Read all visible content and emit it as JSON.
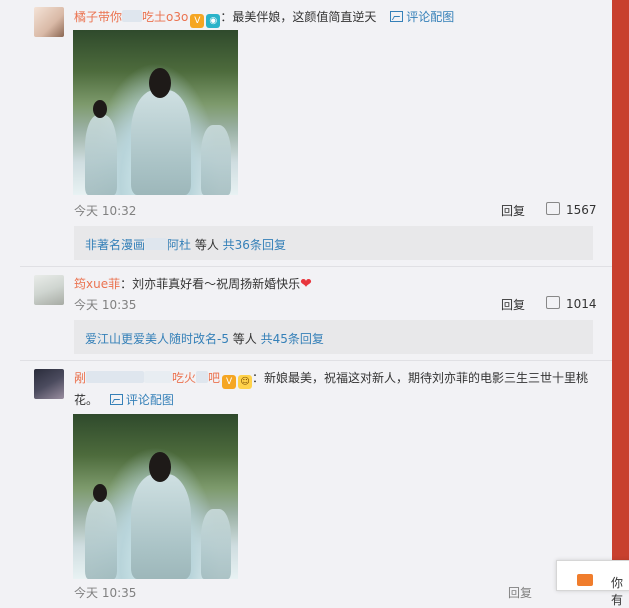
{
  "comments": [
    {
      "username_left": "橘子带",
      "username_right": "吃土o3o",
      "username_mid": "你",
      "text": "：最美伴娘，这颜值简直逆天",
      "view_image_label": "评论配图",
      "timestamp": "今天 10:32",
      "reply_label": "回复",
      "like_count": "1567",
      "replies_summary": {
        "name_left": "非著名漫画",
        "name_right": "阿杜",
        "etc": " 等人 ",
        "count": "共36条回复"
      }
    },
    {
      "username": "筠xue菲",
      "text": "：刘亦菲真好看～祝周扬新婚快乐",
      "timestamp": "今天 10:35",
      "reply_label": "回复",
      "like_count": "1014",
      "replies_summary": {
        "name": "爱江山更爱美人随时改名-5",
        "etc": " 等人 ",
        "count": "共45条回复"
      }
    },
    {
      "username_left": "剐",
      "username_right": "吃火",
      "username_end": "吧",
      "text_line1": "：新娘最美，祝福这对新人，期待刘亦菲的电影三生三世十里桃",
      "text_line2": "花。",
      "view_image_label": "评论配图",
      "bottom_timestamp": "今天 10:35",
      "bottom_reply": "回复"
    }
  ],
  "mail_popup": {
    "text": "你有"
  },
  "colors": {
    "accent": "#eb7350",
    "link_blue": "#3580b8",
    "bg": "#f2f2f5"
  }
}
